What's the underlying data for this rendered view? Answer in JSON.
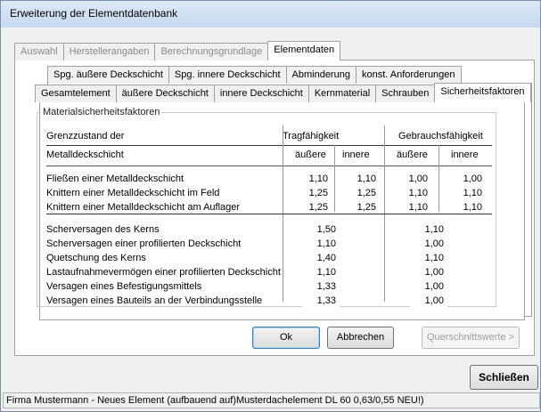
{
  "window": {
    "title": "Erweiterung der Elementdatenbank"
  },
  "tabs_top": [
    {
      "label": "Auswahl",
      "enabled": false
    },
    {
      "label": "Herstellerangaben",
      "enabled": false
    },
    {
      "label": "Berechnungsgrundlage",
      "enabled": false
    },
    {
      "label": "Elementdaten",
      "enabled": true,
      "active": true
    }
  ],
  "tabs_row2": [
    {
      "label": "Spg. äußere Deckschicht"
    },
    {
      "label": "Spg. innere Deckschicht"
    },
    {
      "label": "Abminderung"
    },
    {
      "label": "konst. Anforderungen"
    }
  ],
  "tabs_row3": [
    {
      "label": "Gesamtelement"
    },
    {
      "label": "äußere Deckschicht"
    },
    {
      "label": "innere Deckschicht"
    },
    {
      "label": "Kernmaterial"
    },
    {
      "label": "Schrauben"
    },
    {
      "label": "Sicherheitsfaktoren",
      "active": true
    }
  ],
  "group": {
    "title": "Materialsicherheitsfaktoren",
    "header": {
      "grenzzustand": "Grenzzustand der",
      "tragfaehigkeit": "Tragfähigkeit",
      "gebrauchsfaehigkeit": "Gebrauchsfähigkeit",
      "metalldeckschicht": "Metalldeckschicht",
      "aeussere": "äußere",
      "innere": "innere"
    },
    "rows_metal": [
      {
        "label": "Fließen einer Metalldeckschicht",
        "values": [
          "1,10",
          "1,10",
          "1,00",
          "1,00"
        ]
      },
      {
        "label": "Knittern einer Metalldeckschicht im Feld",
        "values": [
          "1,25",
          "1,25",
          "1,10",
          "1,10"
        ]
      },
      {
        "label": "Knittern einer Metalldeckschicht am Auflager",
        "values": [
          "1,25",
          "1,25",
          "1,10",
          "1,10"
        ]
      }
    ],
    "rows_core": [
      {
        "label": "Scherversagen des Kerns",
        "values": [
          "1,50",
          "1,10"
        ]
      },
      {
        "label": "Scherversagen einer profilierten Deckschicht",
        "values": [
          "1,10",
          "1,00"
        ]
      },
      {
        "label": "Quetschung des Kerns",
        "values": [
          "1,40",
          "1,10"
        ]
      },
      {
        "label": "Lastaufnahmevermögen einer profilierten Deckschicht",
        "values": [
          "1,10",
          "1,00"
        ]
      },
      {
        "label": "Versagen eines Befestigungsmittels",
        "values": [
          "1,33",
          "1,00"
        ]
      },
      {
        "label": "Versagen eines Bauteils an der Verbindungsstelle",
        "values": [
          "1,33",
          "1,00"
        ]
      }
    ]
  },
  "buttons": {
    "ok": "Ok",
    "abbrechen": "Abbrechen",
    "querschnittswerte": "Querschnittswerte >",
    "schliessen": "Schließen"
  },
  "status": "Firma Mustermann - Neues Element  (aufbauend auf)Musterdachelement DL 60 0,63/0,55 NEU!)"
}
